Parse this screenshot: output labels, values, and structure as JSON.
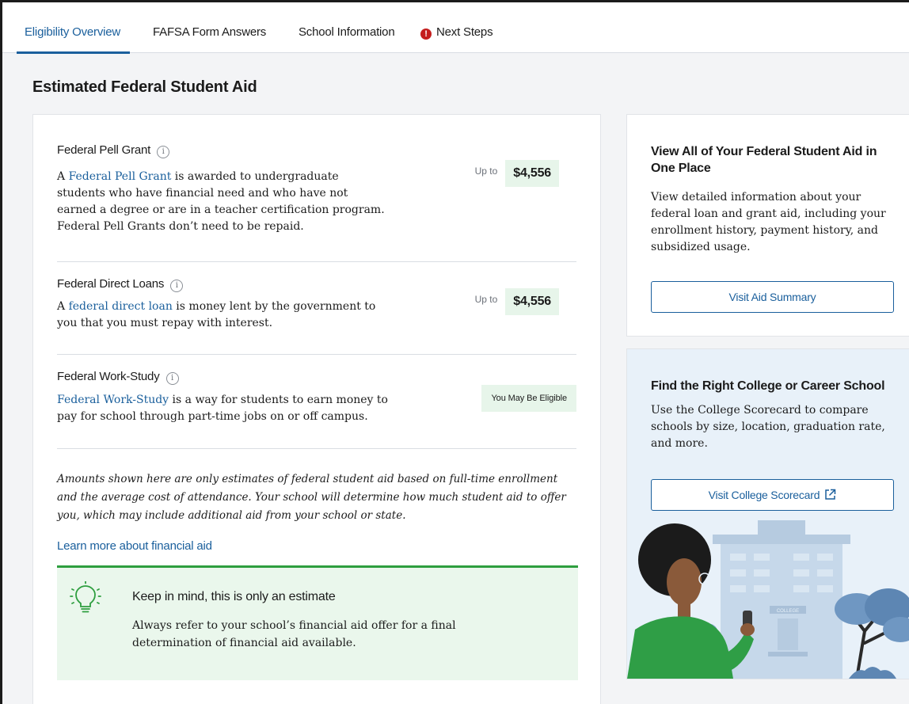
{
  "tabs": [
    {
      "label": "Eligibility Overview",
      "active": true
    },
    {
      "label": "FAFSA Form Answers",
      "active": false
    },
    {
      "label": "School Information",
      "active": false
    },
    {
      "label": "Next Steps",
      "active": false,
      "alert_icon": "exclamation-circle-icon"
    }
  ],
  "page": {
    "title": "Estimated Federal Student Aid"
  },
  "aid": {
    "pell": {
      "name": "Federal Pell Grant",
      "link_text": "Federal Pell Grant",
      "desc_before": "A ",
      "desc_after": " is awarded to undergraduate students who have financial need and who have not earned a degree or are in a teacher certification program. Federal Pell Grants don’t need to be repaid.",
      "upto": "Up to",
      "amount": "$4,556"
    },
    "loans": {
      "name": "Federal Direct Loans",
      "link_text": "federal direct loan",
      "desc_before": "A ",
      "desc_after": " is money lent by the government to you that you must repay with interest.",
      "upto": "Up to",
      "amount": "$4,556"
    },
    "workstudy": {
      "name": "Federal Work-Study",
      "link_text": "Federal Work-Study",
      "desc_after": " is a way for students to earn money to pay for school through part-time jobs on or off campus.",
      "status": "You May Be Eligible"
    }
  },
  "disclaimer": "Amounts shown here are only estimates of federal student aid based on full-time enrollment and the average cost of attendance. Your school will determine how much student aid to offer you, which may include additional aid from your school or state.",
  "learn_more": "Learn more about financial aid",
  "tip": {
    "title": "Keep in mind, this is only an estimate",
    "text": "Always refer to your school’s financial aid offer for a final determination of financial aid available."
  },
  "aid_summary_card": {
    "title": "View All of Your Federal Student Aid in One Place",
    "text": "View detailed information about your federal loan and grant aid, including your enrollment history, payment history, and subsidized usage.",
    "button": "Visit Aid Summary"
  },
  "scorecard_card": {
    "title": "Find the Right College or Career School",
    "text": "Use the College Scorecard to compare schools by size, location, graduation rate, and more.",
    "button": "Visit College Scorecard",
    "illustration_sign": "COLLEGE"
  },
  "colors": {
    "link_blue": "#1a5f9c",
    "success_green": "#2e9e3f",
    "amount_bg": "#e7f5ea",
    "alert_red": "#c41e1e"
  }
}
